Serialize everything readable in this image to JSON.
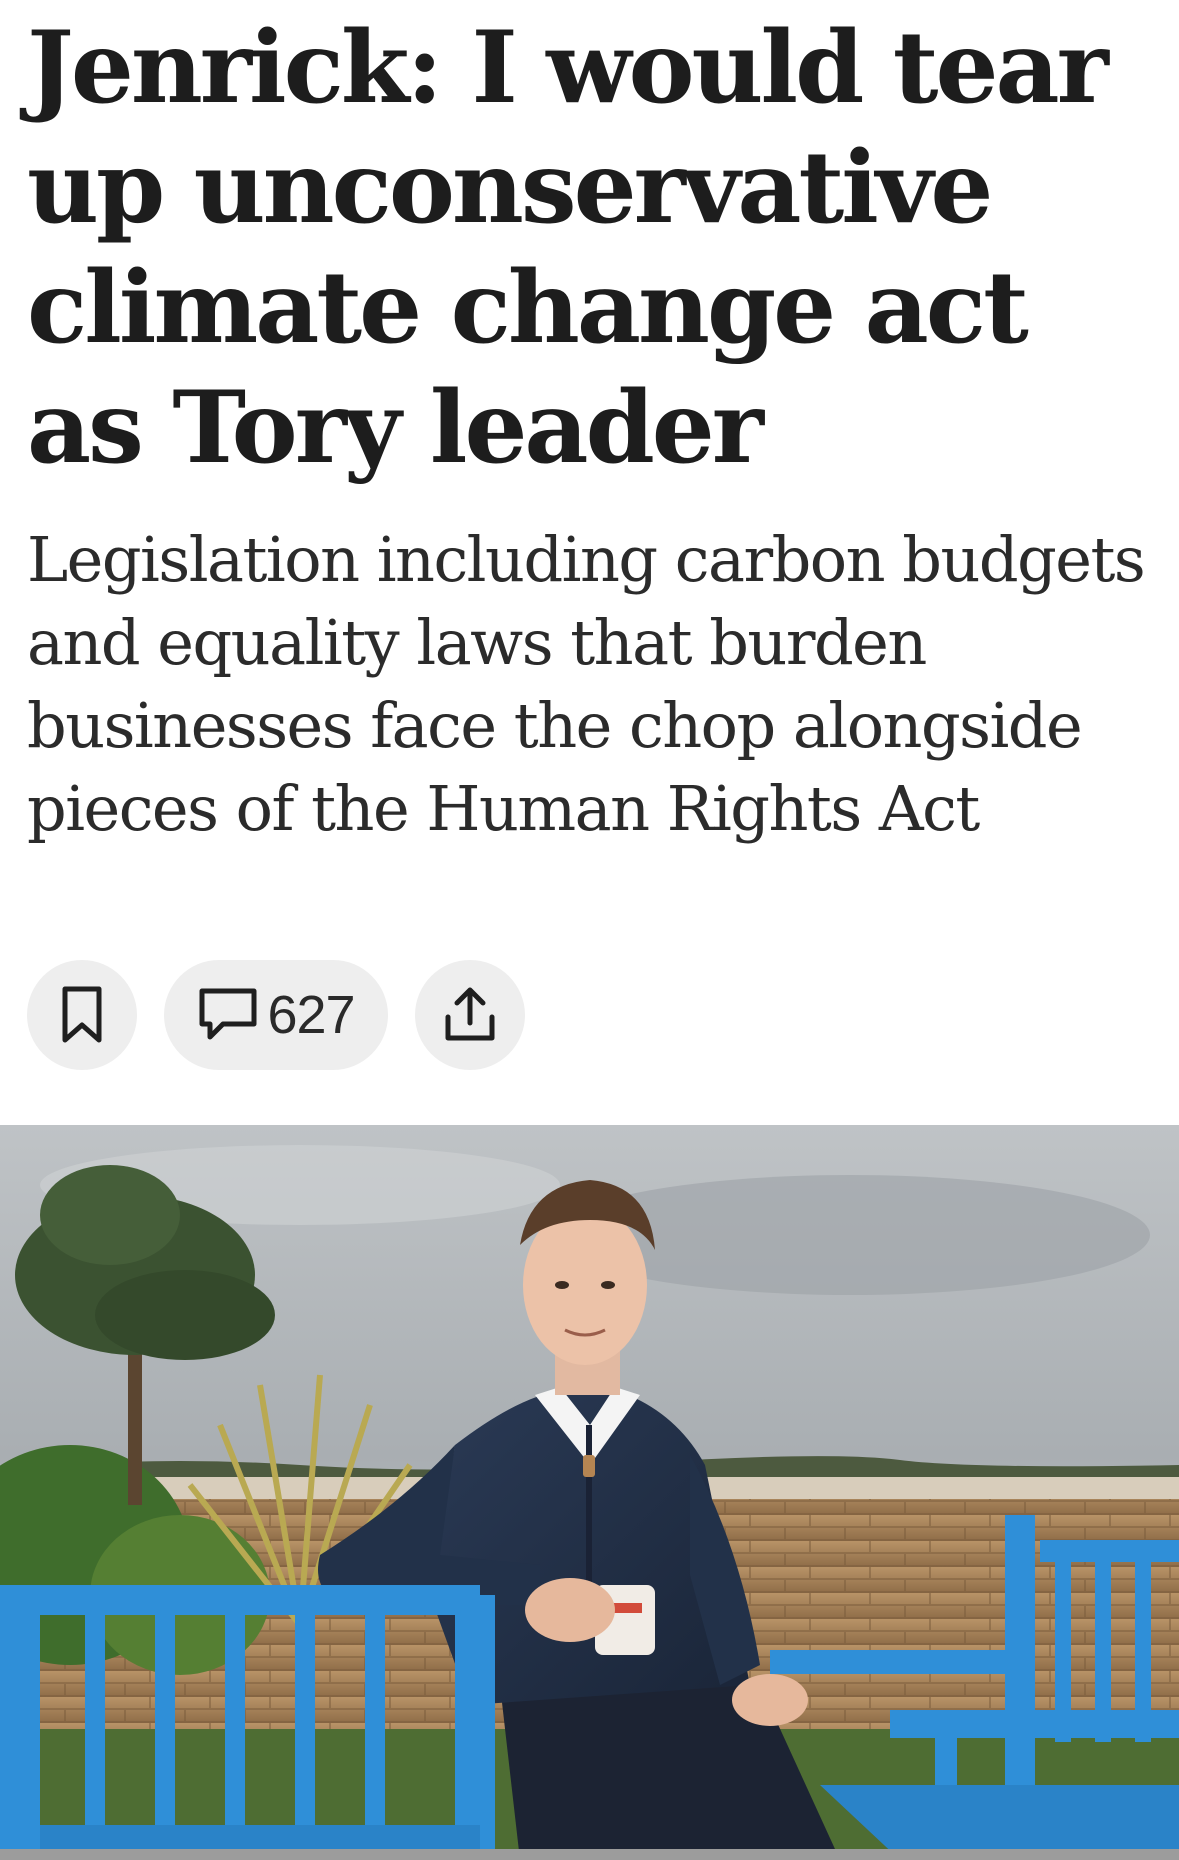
{
  "article": {
    "headline": "Jenrick: I would tear up unconservative climate change act as Tory leader",
    "standfirst": "Legislation including carbon budgets and equality laws that burden businesses face the chop alongside pieces of the Human Rights Act"
  },
  "actions": {
    "bookmark_icon": "bookmark-icon",
    "comment_icon": "comment-icon",
    "comment_count": "627",
    "share_icon": "share-icon"
  },
  "colors": {
    "text": "#1d1d1d",
    "pill_bg": "#eeeeee",
    "bench_blue": "#2f8fd8"
  }
}
